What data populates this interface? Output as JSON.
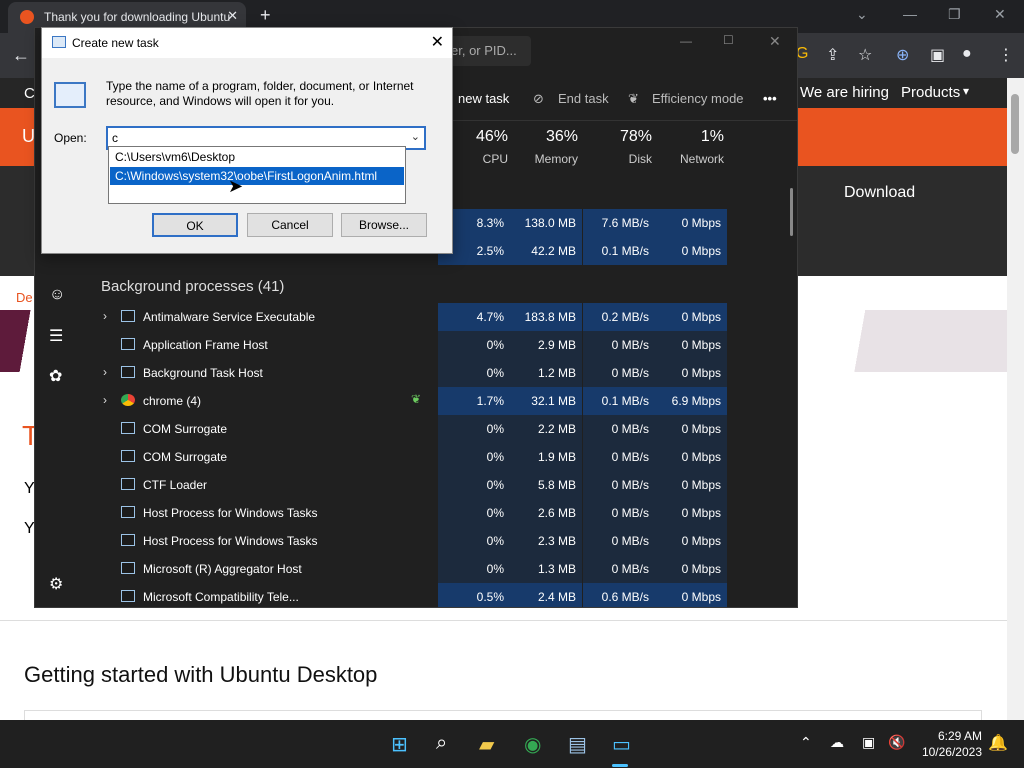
{
  "browser": {
    "tab_title": "Thank you for downloading Ubuntu",
    "new_tab": "+",
    "nav_links": [
      "We are hiring",
      "Products"
    ],
    "download_label": "Download",
    "page_heading": "Getting started with Ubuntu Desktop",
    "page_partial_text": [
      "De",
      "T",
      "Y",
      "Y"
    ]
  },
  "task_manager": {
    "search_placeholder": "er, or PID...",
    "toolbar": {
      "run_new_task": "new task",
      "end_task": "End task",
      "efficiency_mode": "Efficiency mode",
      "more": "•••"
    },
    "columns": [
      {
        "pct": "46%",
        "label": "CPU"
      },
      {
        "pct": "36%",
        "label": "Memory"
      },
      {
        "pct": "78%",
        "label": "Disk"
      },
      {
        "pct": "1%",
        "label": "Network"
      }
    ],
    "app_rows": [
      {
        "cpu": "8.3%",
        "mem": "138.0 MB",
        "disk": "7.6 MB/s",
        "net": "0 Mbps"
      },
      {
        "cpu": "2.5%",
        "mem": "42.2 MB",
        "disk": "0.1 MB/s",
        "net": "0 Mbps"
      }
    ],
    "background_group": "Background processes (41)",
    "processes": [
      {
        "name": "Antimalware Service Executable",
        "expand": true,
        "cpu": "4.7%",
        "mem": "183.8 MB",
        "disk": "0.2 MB/s",
        "net": "0 Mbps"
      },
      {
        "name": "Application Frame Host",
        "expand": false,
        "cpu": "0%",
        "mem": "2.9 MB",
        "disk": "0 MB/s",
        "net": "0 Mbps"
      },
      {
        "name": "Background Task Host",
        "expand": true,
        "cpu": "0%",
        "mem": "1.2 MB",
        "disk": "0 MB/s",
        "net": "0 Mbps"
      },
      {
        "name": "chrome (4)",
        "expand": true,
        "cpu": "1.7%",
        "mem": "32.1 MB",
        "disk": "0.1 MB/s",
        "net": "6.9 Mbps"
      },
      {
        "name": "COM Surrogate",
        "expand": false,
        "cpu": "0%",
        "mem": "2.2 MB",
        "disk": "0 MB/s",
        "net": "0 Mbps"
      },
      {
        "name": "COM Surrogate",
        "expand": false,
        "cpu": "0%",
        "mem": "1.9 MB",
        "disk": "0 MB/s",
        "net": "0 Mbps"
      },
      {
        "name": "CTF Loader",
        "expand": false,
        "cpu": "0%",
        "mem": "5.8 MB",
        "disk": "0 MB/s",
        "net": "0 Mbps"
      },
      {
        "name": "Host Process for Windows Tasks",
        "expand": false,
        "cpu": "0%",
        "mem": "2.6 MB",
        "disk": "0 MB/s",
        "net": "0 Mbps"
      },
      {
        "name": "Host Process for Windows Tasks",
        "expand": false,
        "cpu": "0%",
        "mem": "2.3 MB",
        "disk": "0 MB/s",
        "net": "0 Mbps"
      },
      {
        "name": "Microsoft (R) Aggregator Host",
        "expand": false,
        "cpu": "0%",
        "mem": "1.3 MB",
        "disk": "0 MB/s",
        "net": "0 Mbps"
      },
      {
        "name": "Microsoft Compatibility Tele...",
        "expand": false,
        "cpu": "0.5%",
        "mem": "2.4 MB",
        "disk": "0.6 MB/s",
        "net": "0 Mbps"
      }
    ]
  },
  "dialog": {
    "title": "Create new task",
    "prompt": "Type the name of a program, folder, document, or Internet resource, and Windows will open it for you.",
    "open_label": "Open:",
    "input_value": "c",
    "autocomplete": [
      "C:\\Users\\vm6\\Desktop",
      "C:\\Windows\\system32\\oobe\\FirstLogonAnim.html"
    ],
    "ok": "OK",
    "cancel": "Cancel",
    "browse": "Browse..."
  },
  "taskbar": {
    "time": "6:29 AM",
    "date": "10/26/2023"
  },
  "colors": {
    "ubuntu_orange": "#e95420",
    "highlight_blue": "#0a64c8",
    "tm_heat": "#173a6b"
  }
}
